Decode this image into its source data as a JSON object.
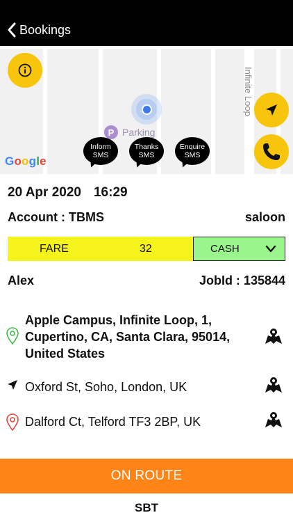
{
  "header": {
    "back_label": "Bookings"
  },
  "map": {
    "google_logo": [
      "G",
      "o",
      "o",
      "g",
      "l",
      "e"
    ],
    "parking_label": "Parking",
    "parking_icon": "P",
    "street_label": "Infinite Loop",
    "sms_buttons": [
      {
        "line1": "Inform",
        "line2": "SMS"
      },
      {
        "line1": "Thanks",
        "line2": "SMS"
      },
      {
        "line1": "Enquire",
        "line2": "SMS"
      }
    ]
  },
  "booking": {
    "date": "20 Apr 2020",
    "time": "16:29",
    "account": "Account : TBMS",
    "vehicle": "saloon",
    "fare_label": "FARE",
    "fare_value": "32",
    "payment": "CASH",
    "passenger": "Alex",
    "job_id": "JobId : 135844"
  },
  "addresses": [
    {
      "type": "pickup",
      "icon": "pin-outline-green-icon",
      "text": "Apple Campus, Infinite Loop, 1, Cupertino, CA, Santa Clara, 95014, United States",
      "bold": true
    },
    {
      "type": "via",
      "icon": "navigation-arrow-icon",
      "text": "Oxford St, Soho, London, UK",
      "bold": false
    },
    {
      "type": "dropoff",
      "icon": "pin-outline-red-icon",
      "text": "Dalford Ct, Telford TF3 2BP, UK",
      "bold": false
    }
  ],
  "actions": {
    "status_button": "ON ROUTE",
    "footer_label": "SBT"
  },
  "colors": {
    "accent": "#f7c60c",
    "fare_bg": "#f6f21b",
    "payment_bg": "#99f58c",
    "status_bg": "#ff8418",
    "header_bg": "#000000"
  }
}
